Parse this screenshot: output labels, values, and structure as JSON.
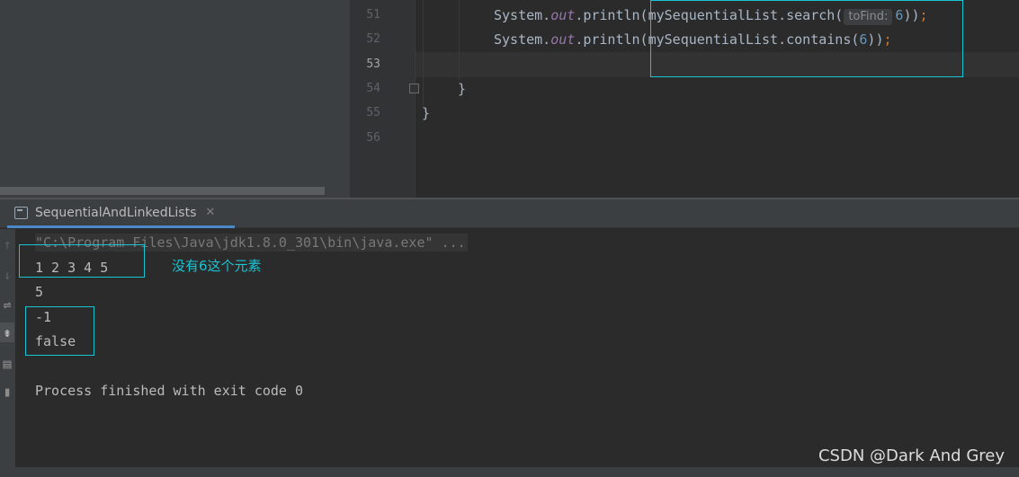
{
  "editor": {
    "line_numbers": [
      "51",
      "52",
      "53",
      "54",
      "55",
      "56"
    ],
    "line51": {
      "prefix": "System.",
      "out": "out",
      "mid": ".println(mySequentialList.search(",
      "hint": "toFind:",
      "arg": "6",
      "close": "))",
      "semi": ";"
    },
    "line52": {
      "prefix": "System.",
      "out": "out",
      "mid": ".println(mySequentialList.contains(",
      "arg": "6",
      "close": "))",
      "semi": ";"
    },
    "line54": {
      "brace": "}"
    },
    "line55": {
      "brace": "}"
    }
  },
  "run": {
    "tab_label": "SequentialAndLinkedLists",
    "close_glyph": "✕",
    "output": {
      "command": "\"C:\\Program Files\\Java\\jdk1.8.0_301\\bin\\java.exe\" ...",
      "line1": "1 2 3 4 5",
      "line2": "5",
      "line3": "-1",
      "line4": "false",
      "line5": "Process finished with exit code 0"
    },
    "annotation": "没有6这个元素"
  },
  "toolbar": {
    "icons": [
      "arrow-up-icon",
      "arrow-down-icon",
      "soft-wrap-icon",
      "scroll-to-end-icon",
      "print-icon",
      "trash-icon"
    ]
  },
  "watermark": "CSDN @Dark And Grey",
  "colors": {
    "background": "#2b2b2b",
    "annotation": "#18c5d5",
    "tab_underline": "#4a88c7"
  }
}
